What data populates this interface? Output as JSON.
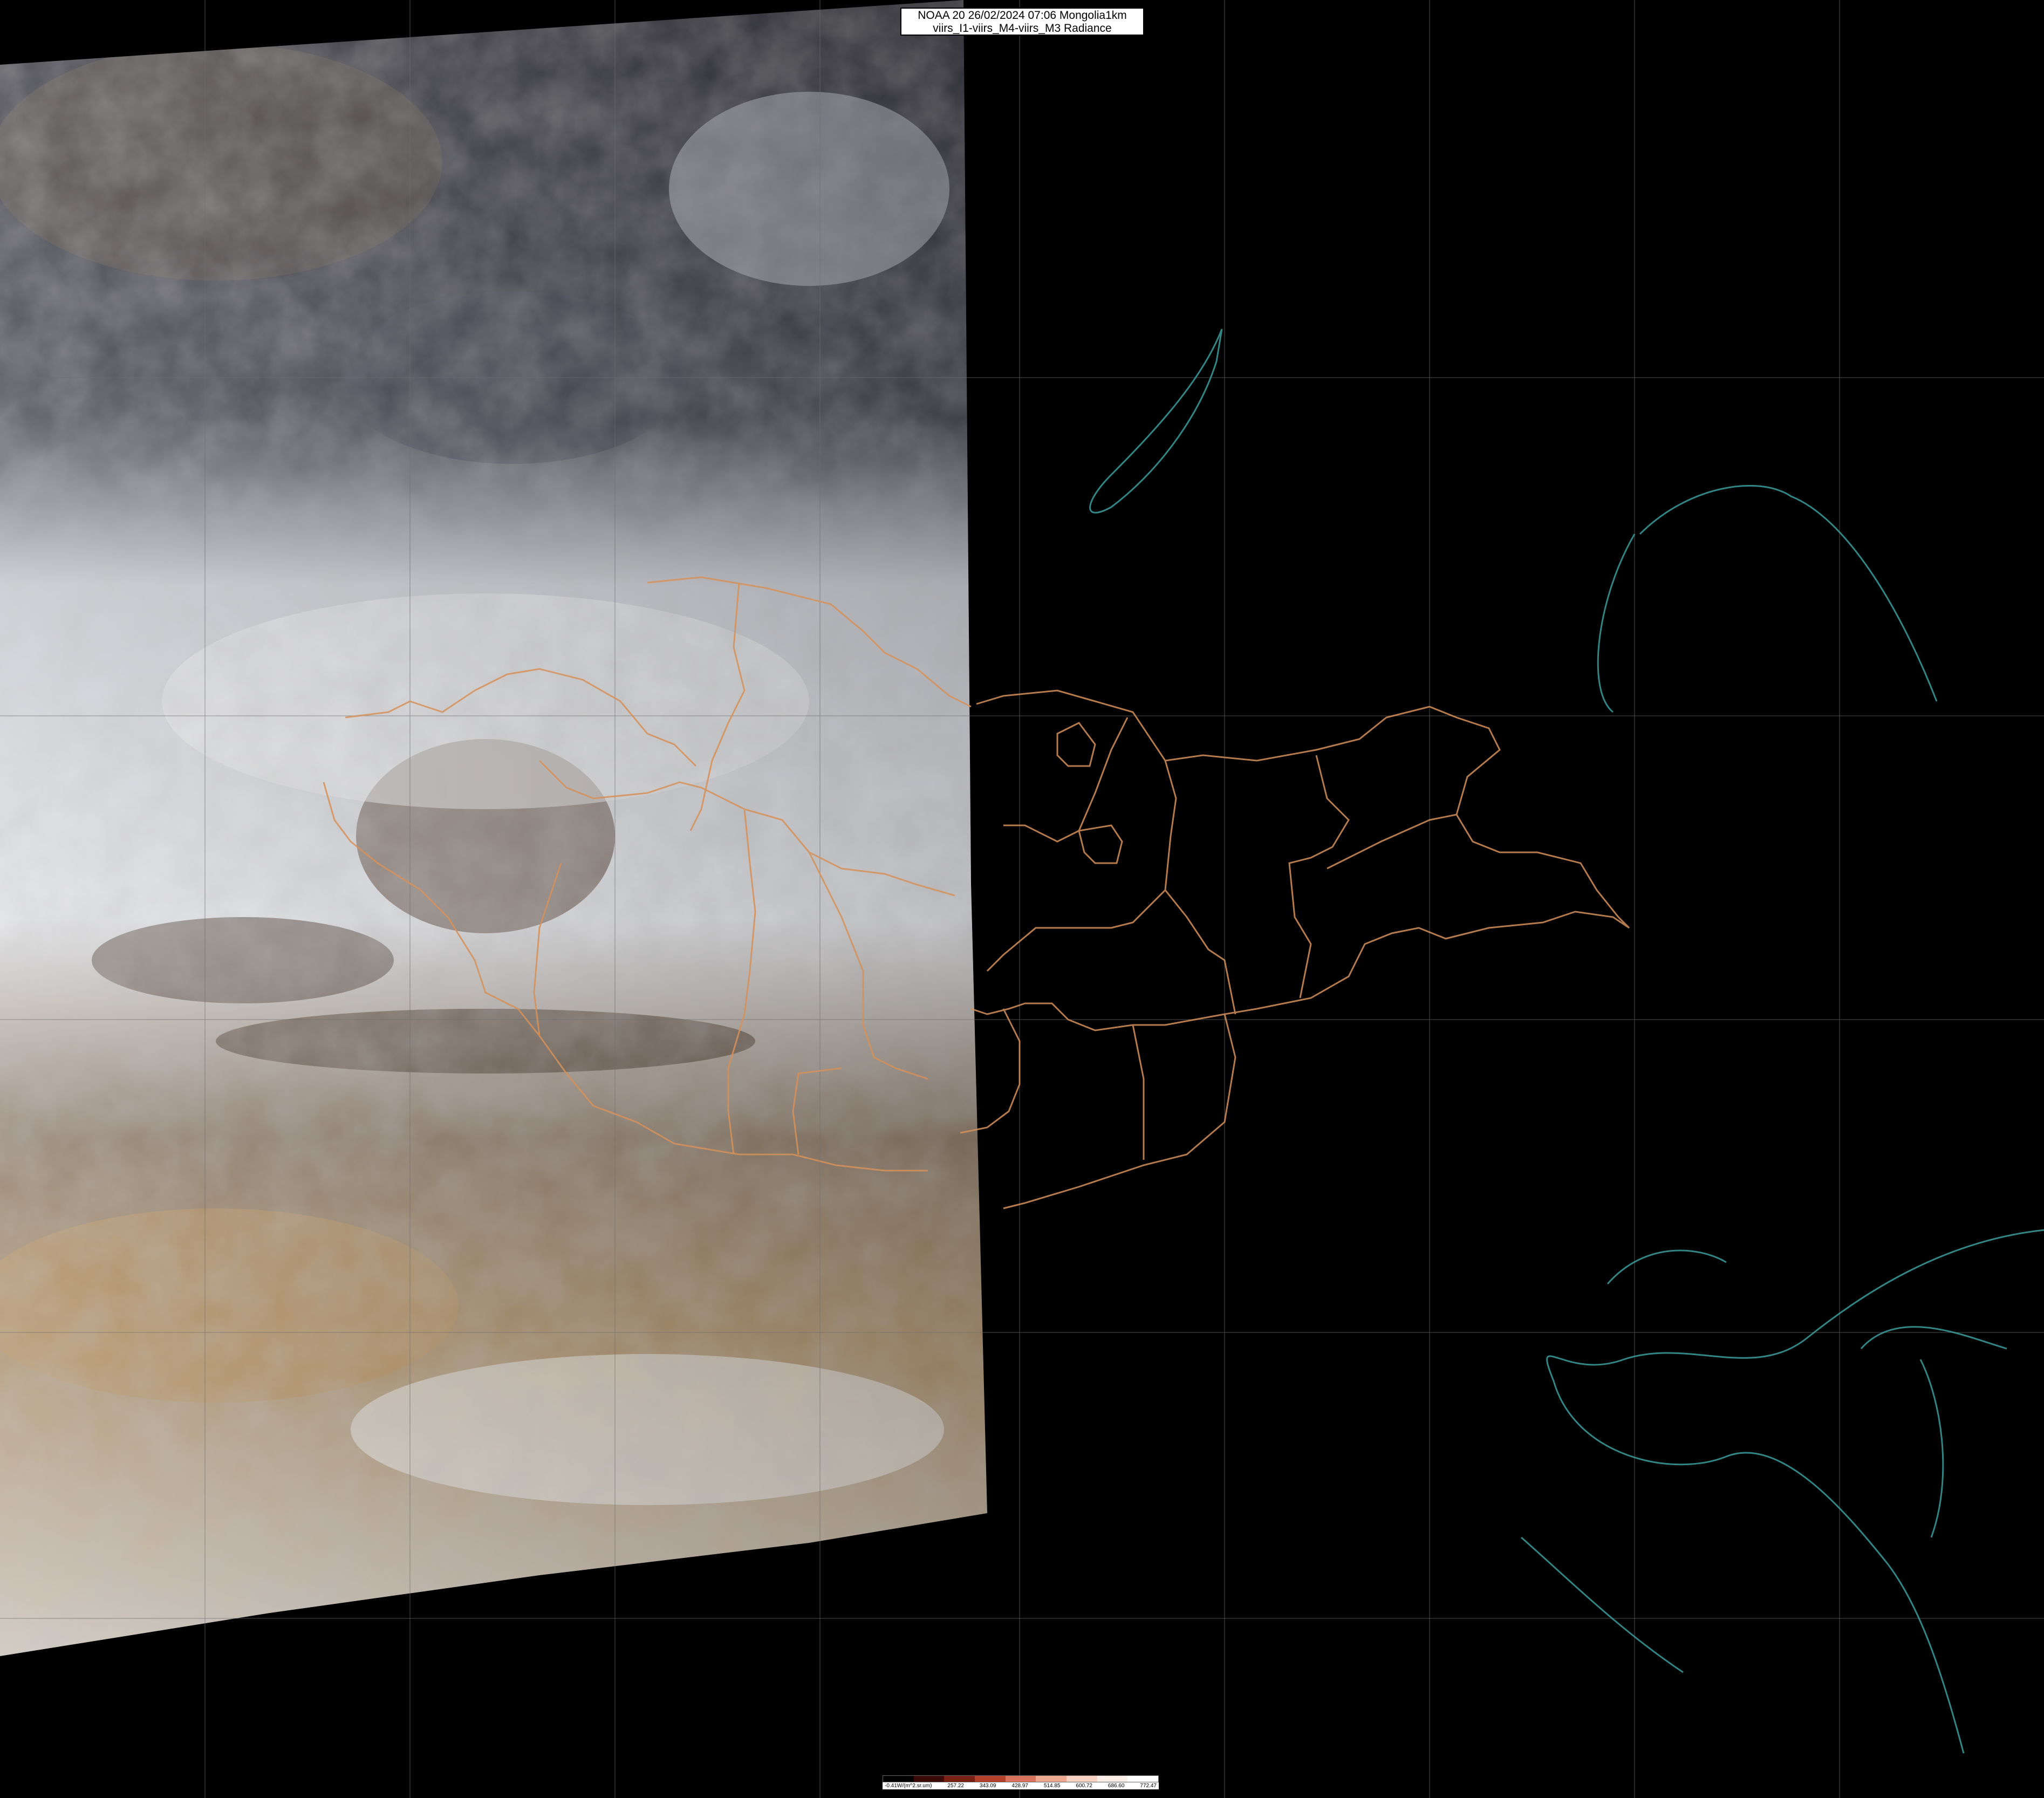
{
  "header": {
    "title_line1": "NOAA 20 26/02/2024 07:06 Mongolia1km",
    "title_line2": "viirs_I1-viirs_M4-viirs_M3 Radiance"
  },
  "colorbar": {
    "unit_label": "-0.41W/(m^2.sr.um)",
    "ticks": [
      "257.22",
      "343.09",
      "428.97",
      "514.85",
      "600.72",
      "686.60",
      "772.47"
    ],
    "colors": [
      "#000000",
      "#3a0a08",
      "#7a1f14",
      "#b3402b",
      "#d9725c",
      "#eda78f",
      "#f6d2c2",
      "#fbeee6",
      "#ffffff"
    ]
  },
  "colors": {
    "background": "#000000",
    "border_lines": "#d6915a",
    "coastline": "#3fa7a6",
    "grid": "#6e6e6e"
  }
}
